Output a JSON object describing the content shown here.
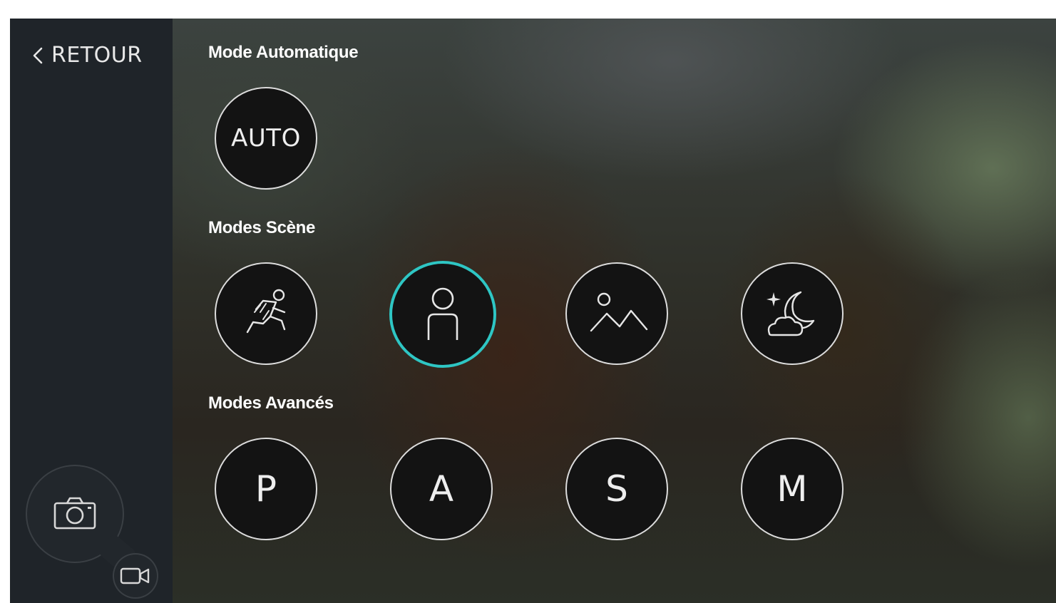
{
  "nav": {
    "back_label": "RETOUR"
  },
  "sections": {
    "auto": {
      "title": "Mode Automatique",
      "button_label": "AUTO"
    },
    "scene": {
      "title": "Modes Scène",
      "items": [
        {
          "icon": "sport-runner-icon",
          "selected": false
        },
        {
          "icon": "portrait-person-icon",
          "selected": true
        },
        {
          "icon": "landscape-mountain-icon",
          "selected": false
        },
        {
          "icon": "night-moon-cloud-icon",
          "selected": false
        }
      ]
    },
    "advanced": {
      "title": "Modes Avancés",
      "items": [
        "P",
        "A",
        "S",
        "M"
      ]
    }
  },
  "capture": {
    "photo_icon": "camera-icon",
    "video_icon": "video-camera-icon"
  },
  "colors": {
    "sidebar": "#1f2429",
    "button_fill": "#131313",
    "button_border": "#dcdcdc",
    "selected_accent": "#2ec6c4",
    "text": "#ffffff"
  }
}
